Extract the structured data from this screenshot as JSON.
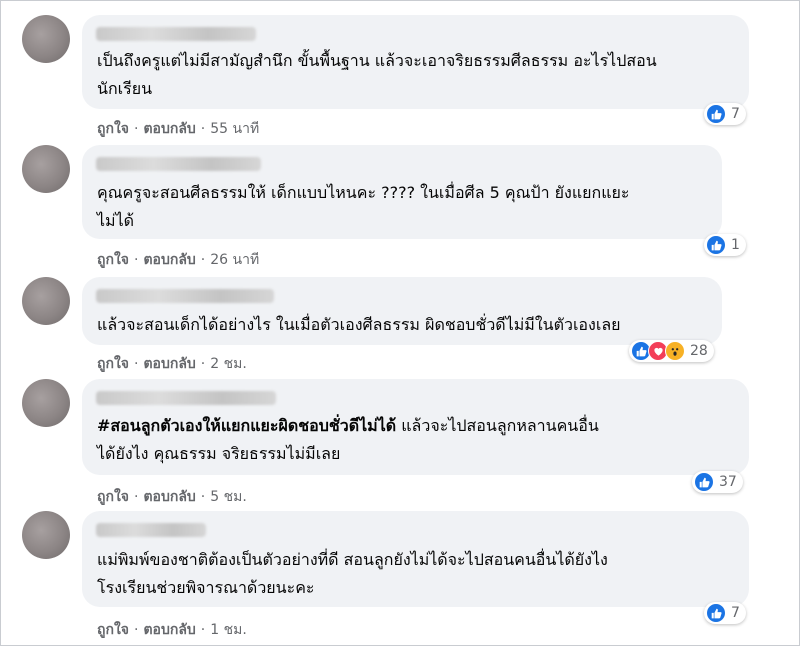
{
  "comments": [
    {
      "text_lines": [
        "เป็นถึงครูแต่ไม่มีสามัญสำนึก ขั้นพื้นฐาน แล้วจะเอาจริยธรรมศีลธรรม อะไรไปสอน",
        "นักเรียน"
      ],
      "like_label": "ถูกใจ",
      "reply_label": "ตอบกลับ",
      "time": "55 นาที",
      "reaction_count": "7",
      "reactions": [
        "like-icon"
      ]
    },
    {
      "text_lines": [
        "คุณครูจะสอนศีลธรรมให้ เด็กแบบไหนคะ ???? ในเมื่อศีล 5 คุณป้า ยังแยกแยะ",
        "ไม่ได้"
      ],
      "like_label": "ถูกใจ",
      "reply_label": "ตอบกลับ",
      "time": "26 นาที",
      "reaction_count": "1",
      "reactions": [
        "like-icon"
      ]
    },
    {
      "text_lines": [
        "แล้วจะสอนเด็กได้อย่างไร ในเมื่อตัวเองศีลธรรม ผิดชอบชั่วดีไม่มีในตัวเองเลย"
      ],
      "like_label": "ถูกใจ",
      "reply_label": "ตอบกลับ",
      "time": "2 ชม.",
      "reaction_count": "28",
      "reactions": [
        "like-icon",
        "love-icon",
        "wow-icon"
      ]
    },
    {
      "hashtag": "#สอนลูกตัวเองให้แยกแยะผิดชอบชั่วดีไม่ได้",
      "text_lines": [
        " แล้วจะไปสอนลูกหลานคนอื่น",
        "ได้ยังไง คุณธรรม จริยธรรมไม่มีเลย"
      ],
      "like_label": "ถูกใจ",
      "reply_label": "ตอบกลับ",
      "time": "5 ชม.",
      "reaction_count": "37",
      "reactions": [
        "like-icon"
      ]
    },
    {
      "text_lines": [
        "แม่พิมพ์ของชาติต้องเป็นตัวอย่างที่ดี สอนลูกยังไม่ได้จะไปสอนคนอื่นได้ยังไง",
        "โรงเรียนช่วยพิจารณาด้วยนะคะ"
      ],
      "like_label": "ถูกใจ",
      "reply_label": "ตอบกลับ",
      "time": "1 ชม.",
      "reaction_count": "7",
      "reactions": [
        "like-icon"
      ]
    }
  ],
  "colors": {
    "bubble": "#f0f2f5",
    "meta": "#65676b",
    "like": "#1b74e4",
    "love": "#f33e58",
    "wow": "#f7b125"
  }
}
